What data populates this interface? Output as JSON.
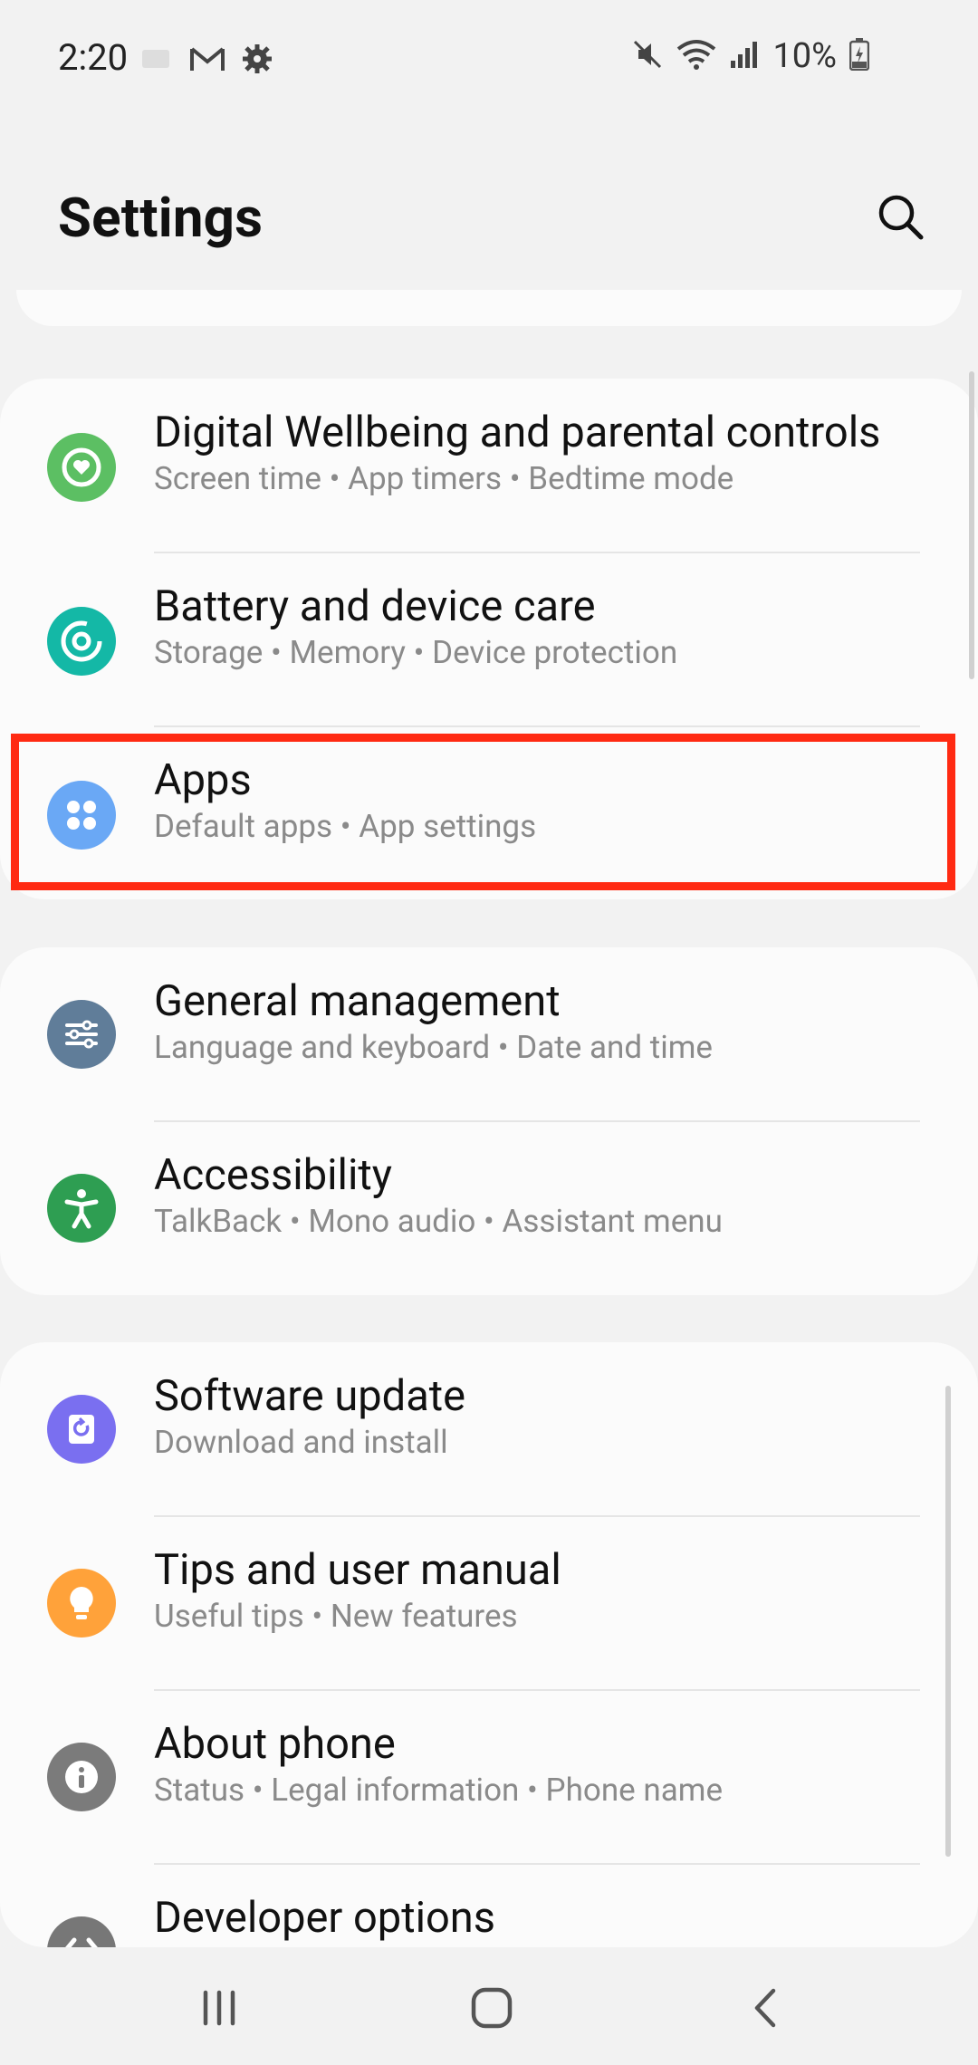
{
  "status_bar": {
    "time": "2:20",
    "battery_percent": "10%",
    "left_icons": [
      "notification-icon",
      "gmail-icon",
      "settings-gear-icon"
    ],
    "right_icons": [
      "mute-icon",
      "wifi-icon",
      "signal-icon",
      "battery-charging-icon"
    ]
  },
  "header": {
    "title": "Settings"
  },
  "groups": [
    {
      "items": [
        {
          "title": "Digital Wellbeing and parental controls",
          "subtitle": "Screen time  •  App timers  •  Bedtime mode",
          "icon": "digital-wellbeing-icon",
          "color": "#5cbf63"
        },
        {
          "title": "Battery and device care",
          "subtitle": "Storage  •  Memory  •  Device protection",
          "icon": "device-care-icon",
          "color": "#14b8a6"
        },
        {
          "title": "Apps",
          "subtitle": "Default apps  •  App settings",
          "icon": "apps-icon",
          "color": "#6aa8f5"
        }
      ]
    },
    {
      "items": [
        {
          "title": "General management",
          "subtitle": "Language and keyboard  •  Date and time",
          "icon": "general-management-icon",
          "color": "#607d99"
        },
        {
          "title": "Accessibility",
          "subtitle": "TalkBack  •  Mono audio  •  Assistant menu",
          "icon": "accessibility-icon",
          "color": "#2e9e52"
        }
      ]
    },
    {
      "items": [
        {
          "title": "Software update",
          "subtitle": "Download and install",
          "icon": "software-update-icon",
          "color": "#7a6ff0"
        },
        {
          "title": "Tips and user manual",
          "subtitle": "Useful tips  •  New features",
          "icon": "tips-icon",
          "color": "#ffa23a"
        },
        {
          "title": "About phone",
          "subtitle": "Status  •  Legal information  •  Phone name",
          "icon": "about-phone-icon",
          "color": "#7b7b7b"
        },
        {
          "title": "Developer options",
          "subtitle": "",
          "icon": "developer-options-icon",
          "color": "#777777"
        }
      ]
    }
  ],
  "highlight_color": "#ff2a12",
  "navbar": {
    "buttons": [
      "recent-apps-icon",
      "home-icon",
      "back-icon"
    ]
  }
}
